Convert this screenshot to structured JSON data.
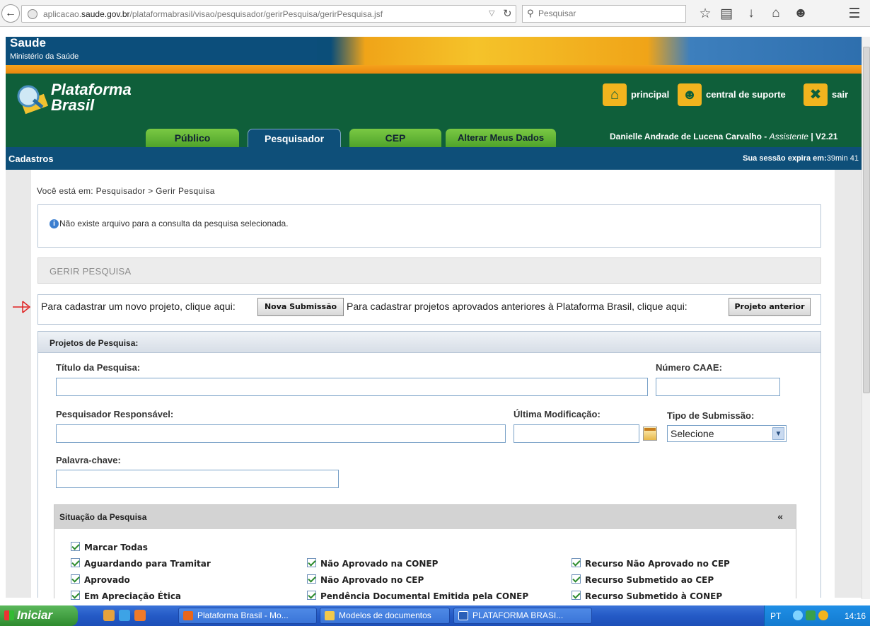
{
  "browser": {
    "url_host": "aplicacao.",
    "url_domain": "saude.gov.br",
    "url_path": "/plataformabrasil/visao/pesquisador/gerirPesquisa/gerirPesquisa.jsf",
    "search_placeholder": "Pesquisar"
  },
  "site": {
    "saude": "Saude",
    "ministerio": "Ministério da Saúde",
    "logo_line1": "Plataforma",
    "logo_line2": "Brasil",
    "links": {
      "principal": "principal",
      "suporte": "central de suporte",
      "sair": "sair"
    },
    "tabs": [
      {
        "label": "Público"
      },
      {
        "label": "Pesquisador"
      },
      {
        "label": "CEP"
      },
      {
        "label": "Alterar Meus Dados"
      }
    ],
    "user_name": "Danielle Andrade de Lucena Carvalho - ",
    "user_role": "Assistente",
    "version": " | V2.21",
    "section": "Cadastros",
    "session_label": "Sua sessão expira em:",
    "session_time": "39min 41"
  },
  "page": {
    "breadcrumb": "Você está em: Pesquisador > Gerir Pesquisa",
    "info_message": "Não existe arquivo para a consulta da pesquisa selecionada.",
    "gerir_title": "GERIR PESQUISA",
    "cad_text1": "Para cadastrar um novo projeto, clique aqui:",
    "btn_nova": "Nova Submissão",
    "cad_text2": "Para cadastrar projetos aprovados anteriores à Plataforma Brasil, clique aqui:",
    "btn_anterior": "Projeto anterior"
  },
  "projects": {
    "title": "Projetos de Pesquisa:",
    "titulo_label": "Título da Pesquisa:",
    "caae_label": "Número CAAE:",
    "pesquisador_label": "Pesquisador Responsável:",
    "ultima_label": "Última Modificação:",
    "tipo_label": "Tipo de Submissão:",
    "tipo_value": "Selecione",
    "palavra_label": "Palavra-chave:"
  },
  "situacao": {
    "title": "Situação da Pesquisa",
    "collapse": "«",
    "marcar_todas": "Marcar Todas",
    "col1": [
      "Aguardando para Tramitar",
      "Aprovado",
      "Em Apreciação Ética"
    ],
    "col2": [
      "Não Aprovado na CONEP",
      "Não Aprovado no CEP",
      "Pendência Documental Emitida pela CONEP"
    ],
    "col3": [
      "Recurso Não Aprovado no CEP",
      "Recurso Submetido ao CEP",
      "Recurso Submetido à CONEP"
    ]
  },
  "taskbar": {
    "start": "Iniciar",
    "items": [
      "Plataforma Brasil - Mo...",
      "Modelos de documentos",
      "PLATAFORMA BRASI..."
    ],
    "lang": "PT",
    "clock": "14:16"
  }
}
